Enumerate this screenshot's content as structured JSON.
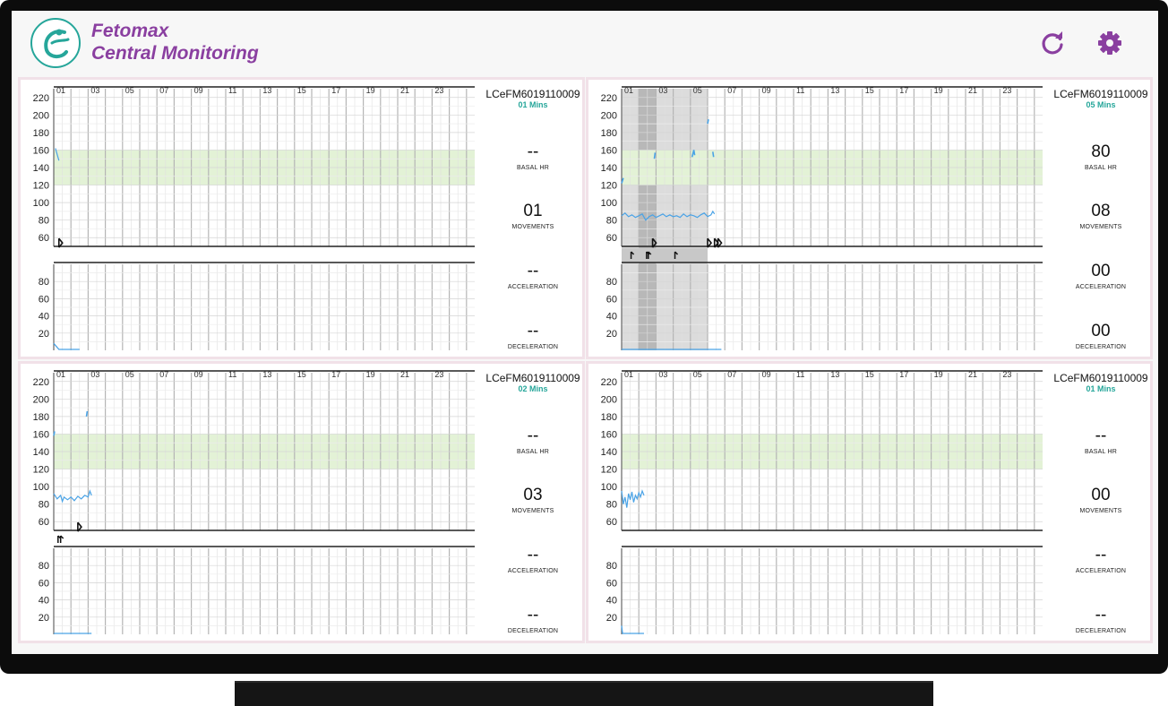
{
  "app": {
    "title_line1": "Fetomax",
    "title_line2": "Central Monitoring",
    "logo_icon": "fetomax-logo",
    "refresh_icon": "refresh-icon",
    "settings_icon": "gear-icon",
    "accent_color": "#8a3fa0",
    "teal_color": "#26a69a"
  },
  "chart_labels": {
    "hours": [
      "01",
      "03",
      "05",
      "07",
      "09",
      "11",
      "13",
      "15",
      "17",
      "19",
      "21",
      "23"
    ],
    "fhr_ticks": [
      "220",
      "200",
      "180",
      "160",
      "140",
      "120",
      "100",
      "80",
      "60"
    ],
    "toco_ticks": [
      "80",
      "60",
      "40",
      "20"
    ],
    "normal_band": [
      120,
      160
    ]
  },
  "monitors": [
    {
      "id": "LCeFM6019110009",
      "elapsed": "01 Mins",
      "basal_hr": "--",
      "basal_hr_label": "BASAL HR",
      "movements": "01",
      "movements_label": "MOVEMENTS",
      "acceleration": "--",
      "acceleration_label": "ACCELERATION",
      "deceleration": "--",
      "deceleration_label": "DECELERATION",
      "fhr_trace": [
        [
          0.1,
          162
        ],
        [
          0.2,
          155
        ],
        [
          0.3,
          148
        ]
      ],
      "extra_traces": [],
      "toco_trace": [
        [
          0.0,
          8
        ],
        [
          0.3,
          1
        ],
        [
          1.5,
          1
        ]
      ],
      "movement_marks": [
        0.3
      ],
      "event_marks": [],
      "highlight": false
    },
    {
      "id": "LCeFM6019110009",
      "elapsed": "05 Mins",
      "basal_hr": "80",
      "basal_hr_label": "BASAL HR",
      "movements": "08",
      "movements_label": "MOVEMENTS",
      "acceleration": "00",
      "acceleration_label": "ACCELERATION",
      "deceleration": "00",
      "deceleration_label": "DECELERATION",
      "fhr_trace": [
        [
          0.0,
          85
        ],
        [
          0.2,
          88
        ],
        [
          0.4,
          84
        ],
        [
          0.6,
          86
        ],
        [
          0.8,
          83
        ],
        [
          1.0,
          85
        ],
        [
          1.2,
          87
        ],
        [
          1.4,
          80
        ],
        [
          1.6,
          84
        ],
        [
          1.8,
          86
        ],
        [
          2.0,
          83
        ],
        [
          2.2,
          85
        ],
        [
          2.4,
          87
        ],
        [
          2.6,
          84
        ],
        [
          2.8,
          86
        ],
        [
          3.0,
          84
        ],
        [
          3.2,
          85
        ],
        [
          3.4,
          83
        ],
        [
          3.6,
          87
        ],
        [
          3.8,
          84
        ],
        [
          4.0,
          86
        ],
        [
          4.2,
          85
        ],
        [
          4.4,
          83
        ],
        [
          4.6,
          86
        ],
        [
          4.8,
          88
        ],
        [
          5.0,
          84
        ],
        [
          5.2,
          86
        ],
        [
          5.3,
          90
        ],
        [
          5.4,
          87
        ]
      ],
      "extra_traces": [
        [
          [
            0.0,
            122
          ],
          [
            0.1,
            128
          ]
        ],
        [
          [
            1.9,
            150
          ],
          [
            1.95,
            157
          ]
        ],
        [
          [
            4.1,
            152
          ],
          [
            4.2,
            160
          ],
          [
            4.25,
            154
          ]
        ],
        [
          [
            5.0,
            190
          ],
          [
            5.05,
            195
          ]
        ],
        [
          [
            5.3,
            158
          ],
          [
            5.35,
            152
          ]
        ]
      ],
      "toco_trace": [
        [
          0.0,
          1
        ],
        [
          5.8,
          1
        ]
      ],
      "movement_marks": [
        1.8,
        5.0,
        5.4,
        5.6
      ],
      "event_marks": [
        0.55,
        1.45,
        1.55,
        3.1
      ],
      "highlight": true
    },
    {
      "id": "LCeFM6019110009",
      "elapsed": "02 Mins",
      "basal_hr": "--",
      "basal_hr_label": "BASAL HR",
      "movements": "03",
      "movements_label": "MOVEMENTS",
      "acceleration": "--",
      "acceleration_label": "ACCELERATION",
      "deceleration": "--",
      "deceleration_label": "DECELERATION",
      "fhr_trace": [
        [
          0.0,
          92
        ],
        [
          0.2,
          86
        ],
        [
          0.4,
          90
        ],
        [
          0.5,
          83
        ],
        [
          0.6,
          88
        ],
        [
          0.8,
          85
        ],
        [
          1.0,
          88
        ],
        [
          1.2,
          84
        ],
        [
          1.4,
          89
        ],
        [
          1.6,
          86
        ],
        [
          1.8,
          90
        ],
        [
          2.0,
          88
        ],
        [
          2.1,
          95
        ],
        [
          2.2,
          90
        ]
      ],
      "extra_traces": [
        [
          [
            0.0,
            158
          ],
          [
            0.05,
            163
          ]
        ],
        [
          [
            1.9,
            180
          ],
          [
            1.95,
            186
          ]
        ]
      ],
      "toco_trace": [
        [
          0.0,
          1
        ],
        [
          2.2,
          1
        ]
      ],
      "movement_marks": [
        1.4
      ],
      "event_marks": [
        0.25,
        0.4
      ],
      "highlight": false
    },
    {
      "id": "LCeFM6019110009",
      "elapsed": "01 Mins",
      "basal_hr": "--",
      "basal_hr_label": "BASAL HR",
      "movements": "00",
      "movements_label": "MOVEMENTS",
      "acceleration": "--",
      "acceleration_label": "ACCELERATION",
      "deceleration": "--",
      "deceleration_label": "DECELERATION",
      "fhr_trace": [
        [
          0.0,
          95
        ],
        [
          0.1,
          80
        ],
        [
          0.2,
          88
        ],
        [
          0.3,
          76
        ],
        [
          0.4,
          92
        ],
        [
          0.5,
          85
        ],
        [
          0.6,
          94
        ],
        [
          0.7,
          82
        ],
        [
          0.8,
          90
        ],
        [
          0.9,
          86
        ],
        [
          1.0,
          93
        ],
        [
          1.1,
          88
        ],
        [
          1.2,
          95
        ],
        [
          1.3,
          90
        ]
      ],
      "extra_traces": [],
      "toco_trace": [
        [
          0.0,
          10
        ],
        [
          0.05,
          1
        ],
        [
          1.3,
          1
        ]
      ],
      "movement_marks": [],
      "event_marks": [],
      "highlight": false
    }
  ]
}
